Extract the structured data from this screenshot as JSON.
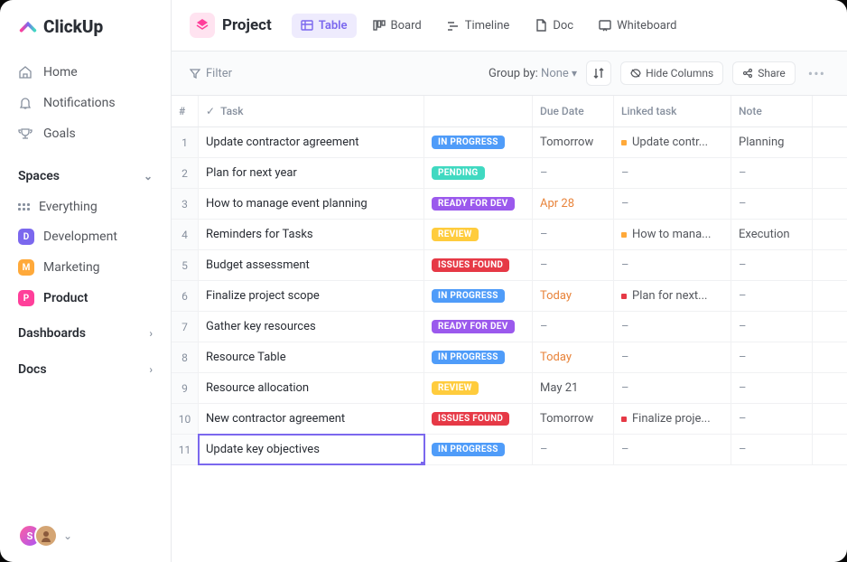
{
  "brand": "ClickUp",
  "nav": {
    "home": "Home",
    "notifications": "Notifications",
    "goals": "Goals"
  },
  "spaces": {
    "header": "Spaces",
    "everything": "Everything",
    "items": [
      {
        "letter": "D",
        "label": "Development",
        "color": "purple"
      },
      {
        "letter": "M",
        "label": "Marketing",
        "color": "orange"
      },
      {
        "letter": "P",
        "label": "Product",
        "color": "pink"
      }
    ]
  },
  "dashboards": "Dashboards",
  "docs": "Docs",
  "header": {
    "title": "Project",
    "views": {
      "table": "Table",
      "board": "Board",
      "timeline": "Timeline",
      "doc": "Doc",
      "whiteboard": "Whiteboard"
    }
  },
  "toolbar": {
    "filter": "Filter",
    "group_by_label": "Group by:",
    "group_by_value": "None",
    "hide_columns": "Hide Columns",
    "share": "Share"
  },
  "columns": {
    "num": "#",
    "task": "Task",
    "status": "",
    "due": "Due Date",
    "linked": "Linked task",
    "note": "Note"
  },
  "rows": [
    {
      "num": "1",
      "task": "Update contractor agreement",
      "status": "IN PROGRESS",
      "status_cls": "st-progress",
      "due": "Tomorrow",
      "due_cls": "due-normal",
      "linked": "Update contr...",
      "linked_dot": "ld-orange",
      "note": "Planning"
    },
    {
      "num": "2",
      "task": "Plan for next year",
      "status": "PENDING",
      "status_cls": "st-pending",
      "due": "–",
      "due_cls": "dash",
      "linked": "–",
      "linked_dot": "",
      "note": "–"
    },
    {
      "num": "3",
      "task": "How to manage event planning",
      "status": "READY FOR DEV",
      "status_cls": "st-ready",
      "due": "Apr 28",
      "due_cls": "due-apr",
      "linked": "–",
      "linked_dot": "",
      "note": "–"
    },
    {
      "num": "4",
      "task": "Reminders for Tasks",
      "status": "REVIEW",
      "status_cls": "st-review",
      "due": "–",
      "due_cls": "dash",
      "linked": "How to mana...",
      "linked_dot": "ld-orange",
      "note": "Execution"
    },
    {
      "num": "5",
      "task": "Budget assessment",
      "status": "ISSUES FOUND",
      "status_cls": "st-issues",
      "due": "–",
      "due_cls": "dash",
      "linked": "–",
      "linked_dot": "",
      "note": "–"
    },
    {
      "num": "6",
      "task": "Finalize project scope",
      "status": "IN PROGRESS",
      "status_cls": "st-progress",
      "due": "Today",
      "due_cls": "due-today",
      "linked": "Plan for next...",
      "linked_dot": "ld-red",
      "note": "–"
    },
    {
      "num": "7",
      "task": "Gather key resources",
      "status": "READY FOR DEV",
      "status_cls": "st-ready",
      "due": "–",
      "due_cls": "dash",
      "linked": "–",
      "linked_dot": "",
      "note": "–"
    },
    {
      "num": "8",
      "task": "Resource Table",
      "status": "IN PROGRESS",
      "status_cls": "st-progress",
      "due": "Today",
      "due_cls": "due-today",
      "linked": "–",
      "linked_dot": "",
      "note": "–"
    },
    {
      "num": "9",
      "task": "Resource allocation",
      "status": "REVIEW",
      "status_cls": "st-review",
      "due": "May 21",
      "due_cls": "due-normal",
      "linked": "–",
      "linked_dot": "",
      "note": "–"
    },
    {
      "num": "10",
      "task": "New contractor agreement",
      "status": "ISSUES FOUND",
      "status_cls": "st-issues",
      "due": "Tomorrow",
      "due_cls": "due-normal",
      "linked": "Finalize proje...",
      "linked_dot": "ld-red",
      "note": "–"
    },
    {
      "num": "11",
      "task": "Update key objectives",
      "status": "IN PROGRESS",
      "status_cls": "st-progress",
      "due": "–",
      "due_cls": "dash",
      "linked": "–",
      "linked_dot": "",
      "note": "–"
    }
  ],
  "avatar_s": "S"
}
